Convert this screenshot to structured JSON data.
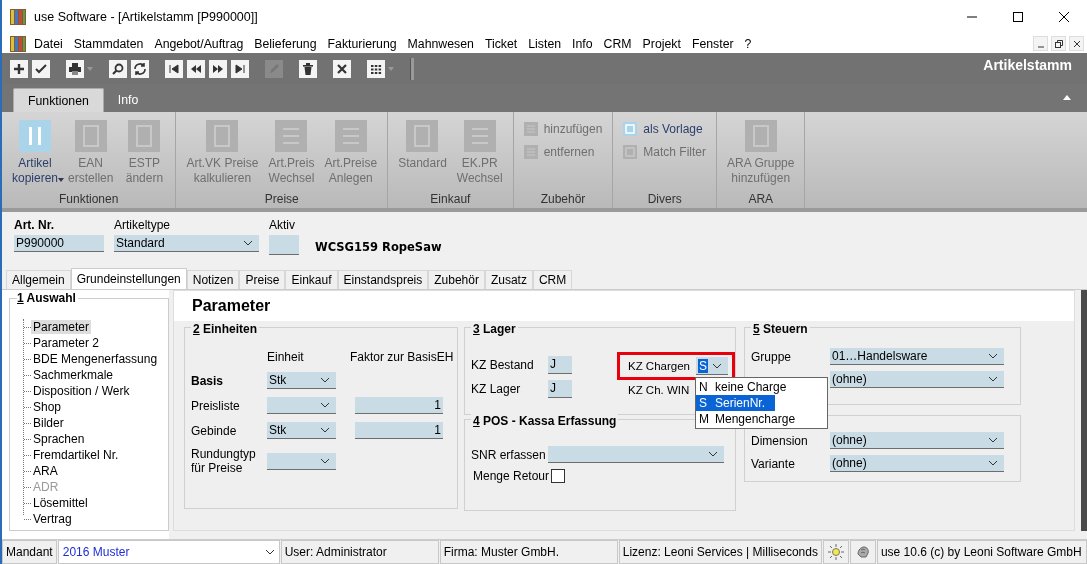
{
  "window": {
    "title": "use Software - [Artikelstamm [P990000]]"
  },
  "menu": [
    "Datei",
    "Stammdaten",
    "Angebot/Auftrag",
    "Belieferung",
    "Fakturierung",
    "Mahnwesen",
    "Ticket",
    "Listen",
    "Info",
    "CRM",
    "Projekt",
    "Fenster",
    "?"
  ],
  "toolbar": {
    "title": "Artikelstamm",
    "groups": [
      [
        {
          "kind": "plus",
          "disabled": false
        },
        {
          "kind": "check",
          "disabled": false
        }
      ],
      [
        {
          "kind": "print",
          "disabled": false,
          "dropdown": true
        }
      ],
      [
        {
          "kind": "search",
          "disabled": false
        },
        {
          "kind": "refresh",
          "disabled": false
        }
      ],
      [
        {
          "kind": "first",
          "disabled": false
        },
        {
          "kind": "prev",
          "disabled": false
        },
        {
          "kind": "next",
          "disabled": false
        },
        {
          "kind": "last",
          "disabled": false
        }
      ],
      [
        {
          "kind": "edit",
          "disabled": true
        }
      ],
      [
        {
          "kind": "delete",
          "disabled": false
        }
      ],
      [
        {
          "kind": "close",
          "disabled": false
        }
      ],
      [
        {
          "kind": "grid",
          "disabled": false,
          "dropdown": true
        }
      ]
    ]
  },
  "ribbon_tabs": [
    {
      "label": "Funktionen",
      "selected": true
    },
    {
      "label": "Info",
      "selected": false
    }
  ],
  "ribbon_groups": [
    {
      "label": "Funktionen",
      "items": [
        {
          "kind": "copy",
          "lines": [
            "Artikel",
            "kopieren"
          ],
          "disabled": false,
          "dropdown": true
        },
        {
          "kind": "sheet",
          "lines": [
            "EAN",
            "erstellen"
          ],
          "disabled": true
        },
        {
          "kind": "sheet",
          "lines": [
            "ESTP",
            "ändern"
          ],
          "disabled": true
        }
      ]
    },
    {
      "label": "Preise",
      "items": [
        {
          "kind": "sheet",
          "lines": [
            "Art.VK Preise",
            "kalkulieren"
          ],
          "disabled": true
        },
        {
          "kind": "lines",
          "lines": [
            "Art.Preis",
            "Wechsel"
          ],
          "disabled": true
        },
        {
          "kind": "lines",
          "lines": [
            "Art.Preise",
            "Anlegen"
          ],
          "disabled": true
        }
      ]
    },
    {
      "label": "Einkauf",
      "items": [
        {
          "kind": "sheet",
          "lines": [
            "Standard"
          ],
          "disabled": true
        },
        {
          "kind": "lines",
          "lines": [
            "EK.PR",
            "Wechsel"
          ],
          "disabled": true
        }
      ]
    },
    {
      "label": "Zubehör",
      "items": [
        {
          "kind": "minilines",
          "lines": [
            "hinzufügen"
          ],
          "disabled": true
        },
        {
          "kind": "minilines",
          "lines": [
            "entfernen"
          ],
          "disabled": true
        }
      ]
    },
    {
      "label": "Divers",
      "items": [
        {
          "kind": "minisheet",
          "lines": [
            "als Vorlage"
          ],
          "disabled": false
        },
        {
          "kind": "minisheet",
          "lines": [
            "Match Filter"
          ],
          "disabled": true
        }
      ]
    },
    {
      "label": "ARA",
      "items": [
        {
          "kind": "sheet",
          "lines": [
            "ARA Gruppe",
            "hinzufügen"
          ],
          "disabled": true
        }
      ]
    }
  ],
  "header": {
    "art_nr": {
      "label": "Art. Nr.",
      "value": "P990000"
    },
    "artikeltype": {
      "label": "Artikeltype",
      "value": "Standard"
    },
    "aktiv": {
      "label": "Aktiv"
    },
    "name": "WCSG159 RopeSaw"
  },
  "tabs": [
    {
      "label": "Allgemein",
      "selected": false
    },
    {
      "label": "Grundeinstellungen",
      "selected": true
    },
    {
      "label": "Notizen",
      "selected": false
    },
    {
      "label": "Preise",
      "selected": false
    },
    {
      "label": "Einkauf",
      "selected": false
    },
    {
      "label": "Einstandspreis",
      "selected": false
    },
    {
      "label": "Zubehör",
      "selected": false
    },
    {
      "label": "Zusatz",
      "selected": false
    },
    {
      "label": "CRM",
      "selected": false
    }
  ],
  "tree": {
    "number": "1",
    "title": "Auswahl",
    "items": [
      {
        "label": "Parameter",
        "selected": true,
        "disabled": false
      },
      {
        "label": "Parameter 2",
        "selected": false,
        "disabled": false
      },
      {
        "label": "BDE Mengenerfassung",
        "selected": false,
        "disabled": false
      },
      {
        "label": "Sachmerkmale",
        "selected": false,
        "disabled": false
      },
      {
        "label": "Disposition / Werk",
        "selected": false,
        "disabled": false
      },
      {
        "label": "Shop",
        "selected": false,
        "disabled": false
      },
      {
        "label": "Bilder",
        "selected": false,
        "disabled": false
      },
      {
        "label": "Sprachen",
        "selected": false,
        "disabled": false
      },
      {
        "label": "Fremdartikel Nr.",
        "selected": false,
        "disabled": false
      },
      {
        "label": "ARA",
        "selected": false,
        "disabled": false
      },
      {
        "label": "ADR",
        "selected": false,
        "disabled": true
      },
      {
        "label": "Lösemittel",
        "selected": false,
        "disabled": false
      },
      {
        "label": "Vertrag",
        "selected": false,
        "disabled": false
      }
    ]
  },
  "page_title": "Parameter",
  "einheiten": {
    "number": "2",
    "title": "Einheiten",
    "col_unit": "Einheit",
    "col_factor": "Faktor zur BasisEH",
    "rows": [
      {
        "label": "Basis",
        "kind": "base",
        "unit": "Stk"
      },
      {
        "label": "Preisliste",
        "kind": "factor",
        "factor": "1"
      },
      {
        "label": "Gebinde",
        "kind": "factor",
        "unit": "Stk",
        "factor": "1"
      },
      {
        "label": "Rundungtyp für Preise",
        "kind": "plain"
      }
    ]
  },
  "lager": {
    "number": "3",
    "title": "Lager",
    "fields": [
      {
        "label": "KZ Bestand",
        "value": "J"
      },
      {
        "label": "KZ Lager",
        "value": "J"
      }
    ],
    "chargen": {
      "label": "KZ Chargen",
      "value": "S",
      "highlighted": true,
      "options": [
        {
          "code": "N",
          "label": "keine Charge",
          "selected": false
        },
        {
          "code": "S",
          "label": "SerienNr.",
          "selected": true
        },
        {
          "code": "M",
          "label": "Mengencharge",
          "selected": false
        }
      ]
    },
    "win_label": "KZ Ch. WIN"
  },
  "pos": {
    "number": "4",
    "title": "POS - Kassa Erfassung",
    "snr_label": "SNR erfassen",
    "retour": {
      "label": "Menge Retour",
      "checked": false
    }
  },
  "steuern": {
    "number": "5",
    "title": "Steuern",
    "rows": [
      {
        "label": "Gruppe",
        "value": "01…Handelsware"
      },
      {
        "value": "(ohne)"
      }
    ]
  },
  "varianten": {
    "rows": [
      {
        "label": "Dimension",
        "value": "(ohne)"
      },
      {
        "label": "Variante",
        "value": "(ohne)"
      }
    ]
  },
  "status_bar": {
    "mandant_label": "Mandant",
    "mandant": "2016 Muster",
    "user": "User: Administrator",
    "firma": "Firma: Muster GmbH.",
    "lizenz": "Lizenz: Leoni Services | Milliseconds",
    "version": "use 10.6 (c) by Leoni Software GmbH"
  }
}
